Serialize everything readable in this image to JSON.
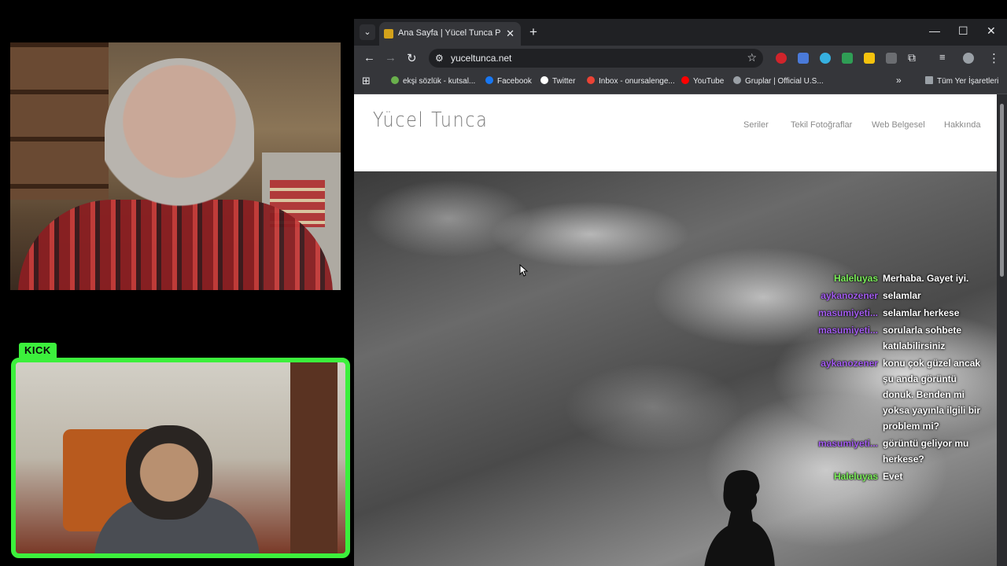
{
  "stream": {
    "platform_badge": "KICK",
    "accent_color": "#3cf03c"
  },
  "browser": {
    "tab_title": "Ana Sayfa | Yücel Tunca Photog",
    "new_tab_label": "+",
    "url": "yuceltunca.net",
    "window_controls": [
      "—",
      "☐",
      "✕"
    ],
    "bookmarks": [
      {
        "label": "ekşi sözlük - kutsal...",
        "icon": "drop-icon",
        "color": "#6ab04c"
      },
      {
        "label": "Facebook",
        "icon": "facebook-icon",
        "color": "#1877f2"
      },
      {
        "label": "Twitter",
        "icon": "x-icon",
        "color": "#ffffff"
      },
      {
        "label": "Inbox - onursalenge...",
        "icon": "gmail-icon",
        "color": "#ea4335"
      },
      {
        "label": "YouTube",
        "icon": "youtube-icon",
        "color": "#ff0000"
      },
      {
        "label": "Gruplar | Official U.S...",
        "icon": "group-icon",
        "color": "#9aa0a6"
      }
    ],
    "all_bookmarks_label": "Tüm Yer İşaretleri"
  },
  "website": {
    "logo": "Yücel Tunca",
    "menu": [
      "Seriler",
      "Tekil Fotoğraflar",
      "Web Belgesel",
      "Hakkında"
    ]
  },
  "chat": [
    {
      "user": "Haleluyas",
      "color": "#7cf05a",
      "text": "Merhaba. Gayet iyi."
    },
    {
      "user": "aykanozener",
      "color": "#a35cf0",
      "text": "selamlar"
    },
    {
      "user": "masumiyeti...",
      "color": "#a35cf0",
      "text": "selamlar herkese"
    },
    {
      "user": "masumiyeti...",
      "color": "#a35cf0",
      "text": "sorularla sohbete katılabilirsiniz"
    },
    {
      "user": "aykanozener",
      "color": "#a35cf0",
      "text": "konu çok güzel ancak şu anda görüntü donuk. Benden mi yoksa yayınla ilgili bir problem mi?"
    },
    {
      "user": "masumiyeti...",
      "color": "#a35cf0",
      "text": "görüntü geliyor mu herkese?"
    },
    {
      "user": "Haleluyas",
      "color": "#7cf05a",
      "text": "Evet"
    }
  ]
}
